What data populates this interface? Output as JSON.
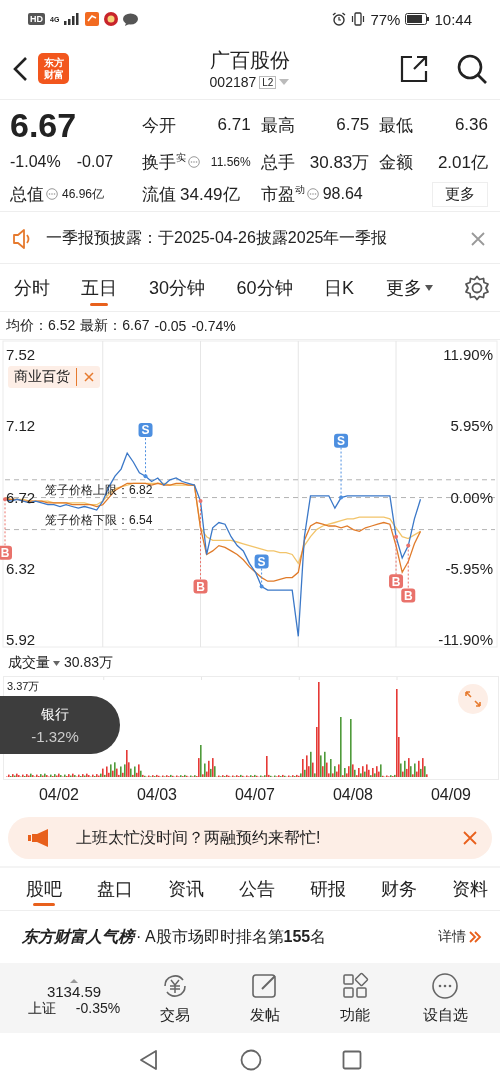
{
  "status_bar": {
    "hd": "HD",
    "network": "4G",
    "battery": "77%",
    "time": "10:44"
  },
  "header": {
    "logo_lines": [
      "东方",
      "财富"
    ],
    "title": "广百股份",
    "code": "002187",
    "level_badge": "L2"
  },
  "quote": {
    "price": "6.67",
    "change_pct": "-1.04%",
    "change": "-0.07",
    "left_stat": {
      "label": "总值",
      "info": true,
      "value": "46.96亿"
    },
    "stats": [
      {
        "label": "今开",
        "info": false,
        "value": "6.71"
      },
      {
        "label": "最高",
        "info": false,
        "value": "6.75"
      },
      {
        "label": "最低",
        "info": false,
        "value": "6.36"
      },
      {
        "label": "换手$^{实}$",
        "info": true,
        "value": "11.56%"
      },
      {
        "label": "总手",
        "info": false,
        "value": "30.83万"
      },
      {
        "label": "金额",
        "info": false,
        "value": "2.01亿"
      },
      {
        "label": "流值",
        "info": false,
        "value": "34.49亿"
      },
      {
        "label": "市盈$^{动}$",
        "info": true,
        "value": "98.64"
      }
    ],
    "more_button": "更多"
  },
  "notice": {
    "text": "一季报预披露：于2025-04-26披露2025年一季报"
  },
  "chart_tabs": [
    {
      "label": "分时",
      "selected": false,
      "dropdown": false
    },
    {
      "label": "五日",
      "selected": true,
      "dropdown": false
    },
    {
      "label": "30分钟",
      "selected": false,
      "dropdown": false
    },
    {
      "label": "60分钟",
      "selected": false,
      "dropdown": false
    },
    {
      "label": "日K",
      "selected": false,
      "dropdown": false
    },
    {
      "label": "更多",
      "selected": false,
      "dropdown": true
    }
  ],
  "summary": {
    "avg": "均价：6.52",
    "latest": "最新：6.67",
    "change": "-0.05",
    "change_pct": "-0.74%"
  },
  "price_chart": {
    "sector_tag": "商业百货",
    "percent_axis": [
      "11.90%",
      "5.95%",
      "0.00%",
      "-5.95%",
      "-11.90%"
    ],
    "chart_data": {
      "type": "line",
      "ylim": [
        5.88,
        7.6
      ],
      "yticks": [
        7.52,
        7.12,
        6.72,
        6.32,
        5.92
      ],
      "series": [
        {
          "color": "#3b78c8",
          "values": [
            6.71,
            6.7,
            6.71,
            6.7,
            6.69,
            6.7,
            6.69,
            6.68,
            6.68,
            6.67,
            6.68,
            6.67,
            6.66,
            6.67,
            6.66,
            6.65,
            6.7,
            6.78,
            6.84,
            6.88,
            6.97,
            6.92,
            6.86,
            6.84,
            6.81,
            6.83,
            6.79,
            6.82,
            6.83,
            6.81,
            6.8,
            6.79,
            6.7,
            6.4,
            6.55,
            6.58,
            6.57,
            6.5,
            6.45,
            6.42,
            6.35,
            6.3,
            6.22,
            6.2,
            6.2,
            6.2,
            6.2,
            6.2,
            5.94,
            6.5,
            6.73,
            6.73,
            6.73,
            6.73,
            6.66,
            6.72,
            6.73,
            6.73,
            6.73,
            6.73,
            6.73,
            6.73,
            6.73,
            6.73,
            6.5,
            6.38,
            6.45,
            6.6,
            6.71
          ]
        },
        {
          "color": "#e07b2a",
          "values": [
            6.71,
            6.71,
            6.71,
            6.7,
            6.7,
            6.7,
            6.7,
            6.69,
            6.69,
            6.69,
            6.69,
            6.68,
            6.68,
            6.68,
            6.68,
            6.67,
            6.68,
            6.72,
            6.76,
            6.78,
            6.8,
            6.8,
            6.8,
            6.8,
            6.79,
            6.8,
            6.79,
            6.79,
            6.8,
            6.8,
            6.79,
            6.79,
            6.55,
            6.4,
            6.42,
            6.45,
            6.44,
            6.42,
            6.4,
            6.37,
            6.33,
            6.3,
            6.27,
            6.25,
            6.25,
            6.26,
            6.27,
            6.27,
            6.3,
            6.48,
            6.56,
            6.58,
            6.57,
            6.56,
            6.56,
            6.55,
            6.56,
            6.54,
            6.53,
            6.55,
            6.56,
            6.57,
            6.58,
            6.57,
            6.45,
            6.3,
            6.36,
            6.46,
            6.53
          ]
        },
        {
          "color": "#f2c46a",
          "values": [
            6.72,
            6.71,
            6.71,
            6.71,
            6.7,
            6.7,
            6.7,
            6.7,
            6.69,
            6.69,
            6.69,
            6.69,
            6.69,
            6.69,
            6.68,
            6.68,
            6.7,
            6.74,
            6.77,
            6.78,
            6.79,
            6.8,
            6.8,
            6.8,
            6.8,
            6.8,
            6.8,
            6.79,
            6.79,
            6.79,
            6.79,
            6.79,
            6.55,
            6.5,
            6.48,
            6.48,
            6.48,
            6.48,
            6.47,
            6.46,
            6.45,
            6.44,
            6.43,
            6.42,
            6.42,
            6.41,
            6.41,
            6.4,
            6.35,
            6.45,
            6.5,
            6.54,
            6.56,
            6.57,
            6.58,
            6.59,
            6.6,
            6.6,
            6.61,
            6.61,
            6.61,
            6.61,
            6.61,
            6.6,
            6.55,
            6.5,
            6.49,
            6.51,
            6.53
          ]
        }
      ],
      "grid": true
    },
    "cage_limits": [
      "笼子价格上限：6.82",
      "笼子价格下限：6.54"
    ],
    "trade_marks": [
      {
        "kind": "buy",
        "label": "B"
      },
      {
        "kind": "sell",
        "label": "S"
      },
      {
        "kind": "buy",
        "label": "B"
      },
      {
        "kind": "sell",
        "label": "S"
      },
      {
        "kind": "sell",
        "label": "S"
      },
      {
        "kind": "buy",
        "label": "B"
      },
      {
        "kind": "buy",
        "label": "B"
      }
    ]
  },
  "volume": {
    "label": "成交量",
    "total": "30.83万",
    "max_label": "3.37万",
    "sector_popup": {
      "name": "银行",
      "change": "-1.32%"
    }
  },
  "dates": [
    "04/02",
    "04/03",
    "04/07",
    "04/08",
    "04/09"
  ],
  "ad_banner": {
    "text": "上班太忙没时间？两融预约来帮忙!"
  },
  "section_tabs": [
    {
      "label": "股吧",
      "selected": true
    },
    {
      "label": "盘口",
      "selected": false
    },
    {
      "label": "资讯",
      "selected": false
    },
    {
      "label": "公告",
      "selected": false
    },
    {
      "label": "研报",
      "selected": false
    },
    {
      "label": "财务",
      "selected": false
    },
    {
      "label": "资料",
      "selected": false
    }
  ],
  "ranking": {
    "brand": "东方财富人气榜",
    "text": "· A股市场即时排名第**155**名",
    "link": "详情"
  },
  "toolbar": {
    "index": {
      "value": "3134.59",
      "name": "上证",
      "change": "-0.35%"
    },
    "items": [
      {
        "kind": "trade",
        "label": "交易"
      },
      {
        "kind": "post",
        "label": "发帖"
      },
      {
        "kind": "functions",
        "label": "功能"
      },
      {
        "kind": "watchlist",
        "label": "设自选"
      }
    ]
  }
}
